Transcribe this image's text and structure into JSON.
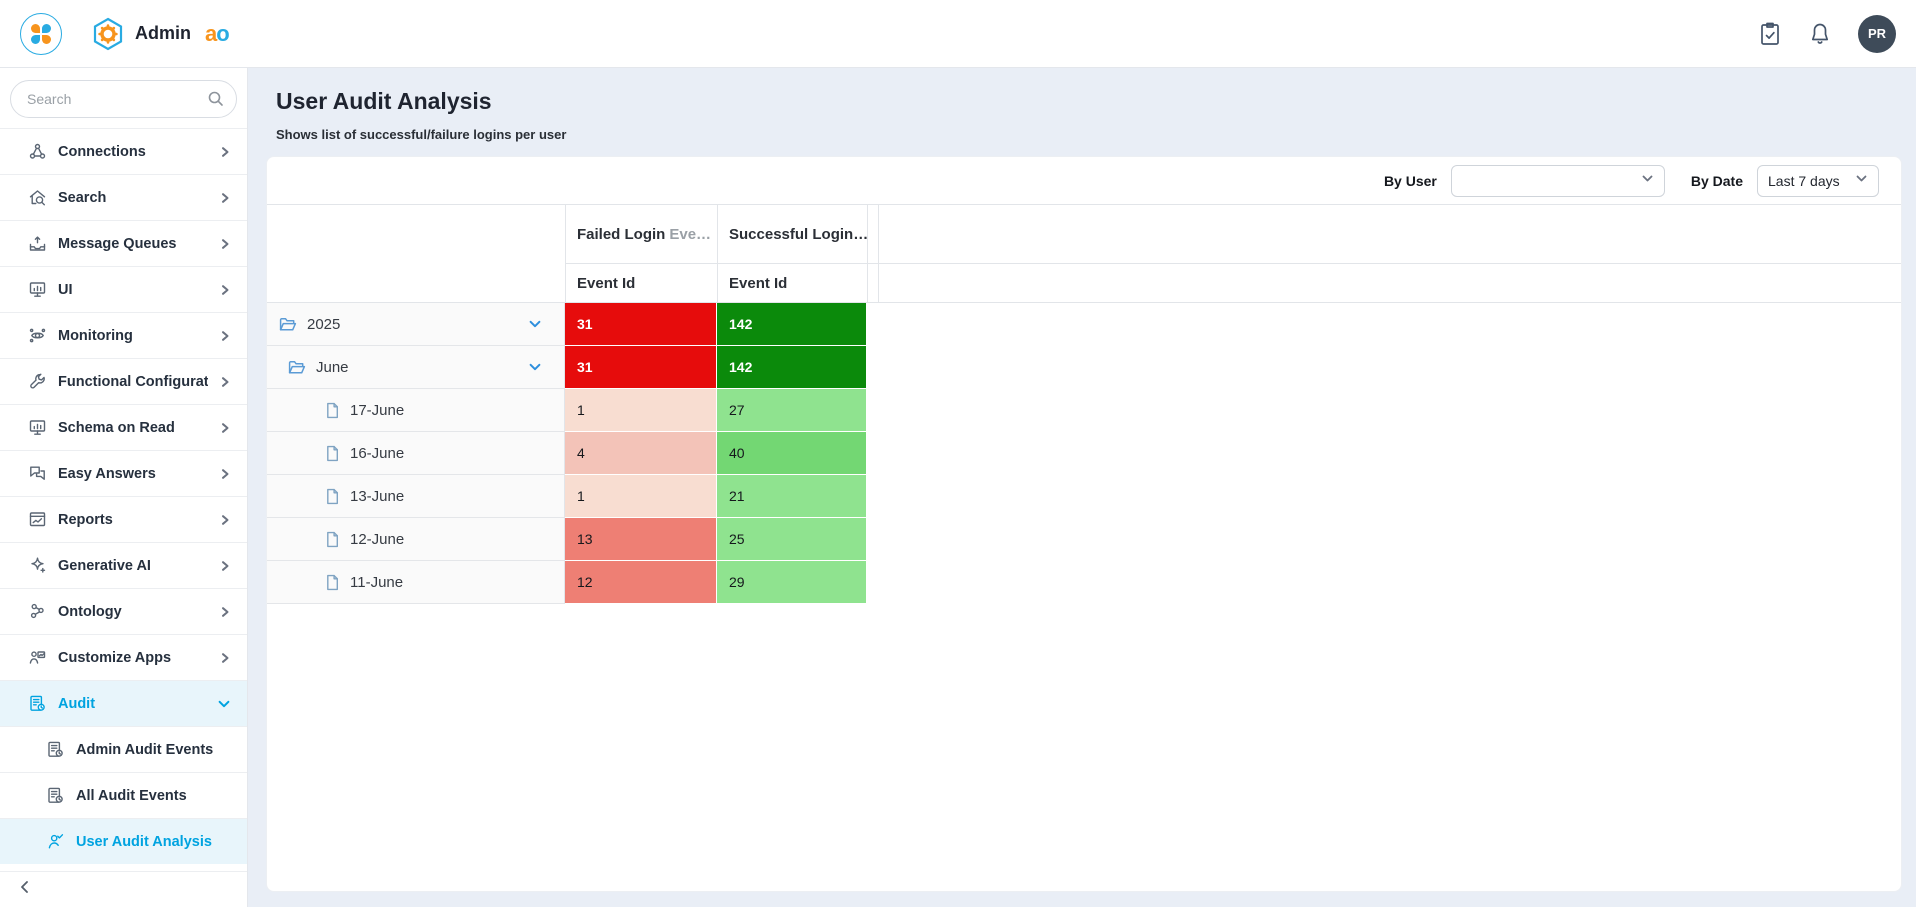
{
  "header": {
    "app_label": "Admin",
    "logo": {
      "a": "a",
      "o": "o"
    },
    "avatar_initials": "PR",
    "icons": [
      "pinwheel-logo-icon",
      "hexagon-gear-icon",
      "clipboard-check-icon",
      "bell-icon"
    ]
  },
  "sidebar": {
    "search_placeholder": "Search",
    "items": [
      {
        "label": "Connections",
        "icon": "network-icon",
        "has_children": true
      },
      {
        "label": "Search",
        "icon": "home-search-icon",
        "has_children": true
      },
      {
        "label": "Message Queues",
        "icon": "inbox-icon",
        "has_children": true
      },
      {
        "label": "UI",
        "icon": "monitor-icon",
        "has_children": true
      },
      {
        "label": "Monitoring",
        "icon": "monitor-eye-icon",
        "has_children": true
      },
      {
        "label": "Functional Configurati…",
        "icon": "wrench-icon",
        "has_children": true
      },
      {
        "label": "Schema on Read",
        "icon": "monitor-icon",
        "has_children": true
      },
      {
        "label": "Easy Answers",
        "icon": "chat-icon",
        "has_children": true
      },
      {
        "label": "Reports",
        "icon": "report-icon",
        "has_children": true
      },
      {
        "label": "Generative AI",
        "icon": "sparkle-icon",
        "has_children": true
      },
      {
        "label": "Ontology",
        "icon": "nodes-icon",
        "has_children": true
      },
      {
        "label": "Customize Apps",
        "icon": "person-chart-icon",
        "has_children": true
      },
      {
        "label": "Audit",
        "icon": "audit-icon",
        "active": true,
        "expanded": true,
        "children": [
          {
            "label": "Admin Audit Events",
            "icon": "audit-icon"
          },
          {
            "label": "All Audit Events",
            "icon": "audit-icon"
          },
          {
            "label": "User Audit Analysis",
            "icon": "person-check-icon",
            "active": true
          }
        ]
      }
    ]
  },
  "main": {
    "title": "User Audit Analysis",
    "subtitle": "Shows list of successful/failure logins per user",
    "filters": {
      "by_user_label": "By User",
      "by_user_value": "",
      "by_date_label": "By Date",
      "by_date_value": "Last 7 days"
    }
  },
  "table": {
    "header_groups": [
      {
        "label": "Failed Login",
        "truncated": "Eve…",
        "sub_label": "Event Id"
      },
      {
        "label": "Successful Login…",
        "truncated": "",
        "sub_label": "Event Id"
      }
    ],
    "rows": [
      {
        "label": "2025",
        "level": 0,
        "icon": "folder-open-icon",
        "expanded": true,
        "failed": "31",
        "success": "142",
        "failed_bg": "#e60c0c",
        "success_bg": "#0b8a0b",
        "value_color": "#ffffff",
        "value_bold": true
      },
      {
        "label": "June",
        "level": 1,
        "icon": "folder-open-icon",
        "expanded": true,
        "failed": "31",
        "success": "142",
        "failed_bg": "#e60c0c",
        "success_bg": "#0b8a0b",
        "value_color": "#ffffff",
        "value_bold": true
      },
      {
        "label": "17-June",
        "level": 2,
        "icon": "file-icon",
        "failed": "1",
        "success": "27",
        "failed_bg": "#f8ddd1",
        "success_bg": "#8fe38f",
        "value_color": "#15181c"
      },
      {
        "label": "16-June",
        "level": 2,
        "icon": "file-icon",
        "failed": "4",
        "success": "40",
        "failed_bg": "#f3c3b8",
        "success_bg": "#73d773",
        "value_color": "#15181c"
      },
      {
        "label": "13-June",
        "level": 2,
        "icon": "file-icon",
        "failed": "1",
        "success": "21",
        "failed_bg": "#f8ddd1",
        "success_bg": "#8fe38f",
        "value_color": "#15181c"
      },
      {
        "label": "12-June",
        "level": 2,
        "icon": "file-icon",
        "failed": "13",
        "success": "25",
        "failed_bg": "#ee7f74",
        "success_bg": "#8fe38f",
        "value_color": "#15181c"
      },
      {
        "label": "11-June",
        "level": 2,
        "icon": "file-icon",
        "failed": "12",
        "success": "29",
        "failed_bg": "#ee7f74",
        "success_bg": "#8fe38f",
        "value_color": "#15181c"
      }
    ]
  },
  "colors": {
    "accent_blue": "#00a3e0",
    "brand_orange": "#f7941d",
    "brand_blue": "#29abe2",
    "failed_strong": "#e60c0c",
    "success_strong": "#0b8a0b",
    "page_background": "#e9eef6"
  }
}
